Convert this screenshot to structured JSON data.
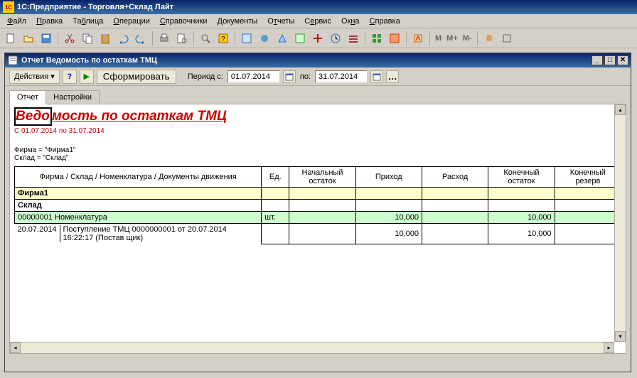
{
  "app": {
    "title": "1С:Предприятие - Торговля+Склад Лайт",
    "icon": "1С"
  },
  "menu": {
    "file": "Файл",
    "edit": "Правка",
    "table": "Таблица",
    "operations": "Операции",
    "refs": "Справочники",
    "docs": "Документы",
    "reports": "Отчеты",
    "service": "Сервис",
    "windows": "Окна",
    "help": "Справка"
  },
  "toolbar_text": {
    "m": "M",
    "mplus": "M+",
    "mminus": "M-"
  },
  "child": {
    "title": "Отчет  Ведомость по остаткам ТМЦ",
    "toolbar": {
      "actions": "Действия",
      "form": "Сформировать",
      "period_from_label": "Период с:",
      "period_from": "01.07.2014",
      "period_to_label": "по:",
      "period_to": "31.07.2014"
    },
    "tabs": {
      "report": "Отчет",
      "settings": "Настройки"
    }
  },
  "report": {
    "title_part1": "Ведо",
    "title_part2": "мость по остаткам ТМЦ",
    "period": "С 01.07.2014 по 31.07.2014",
    "filter1": "Фирма = \"Фирма1\"",
    "filter2": "Склад = \"Склад\"",
    "headers": {
      "c1": "Фирма / Склад / Номенклатура / Документы движения",
      "c2": "Ед.",
      "c3": "Начальный остаток",
      "c4": "Приход",
      "c5": "Расход",
      "c6": "Конечный остаток",
      "c7": "Конечный резерв"
    },
    "rows": {
      "firma": "Фирма1",
      "sklad": "Склад",
      "nomen_code": "00000001",
      "nomen_name": "Номенклатура",
      "nomen_unit": "шт.",
      "nomen_prihod": "10,000",
      "nomen_kon": "10,000",
      "doc_date": "20.07.2014",
      "doc_name": "Поступление ТМЦ 0000000001 от 20.07.2014 16:22:17 (Постав щик)",
      "doc_prihod": "10,000",
      "doc_kon": "10,000"
    }
  }
}
